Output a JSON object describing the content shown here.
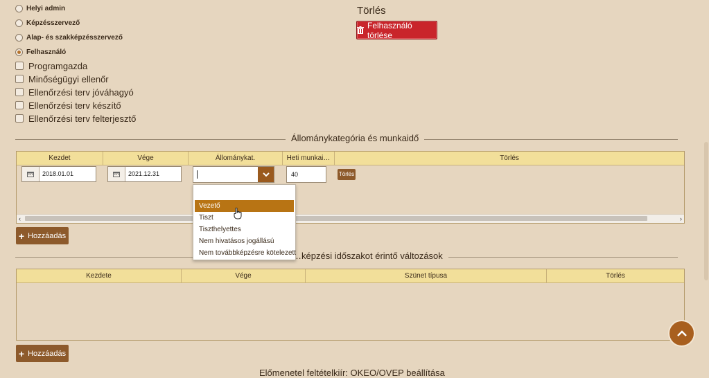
{
  "roles": [
    {
      "label": "Helyi admin",
      "checked": false
    },
    {
      "label": "Képzésszervező",
      "checked": false
    },
    {
      "label": "Alap- és szakképzésszervező",
      "checked": false
    },
    {
      "label": "Felhasználó",
      "checked": true
    }
  ],
  "permissions": [
    {
      "label": "Programgazda",
      "checked": false
    },
    {
      "label": "Minőségügyi ellenőr",
      "checked": false
    },
    {
      "label": "Ellenőrzési terv jóváhagyó",
      "checked": false
    },
    {
      "label": "Ellenőrzési terv készítő",
      "checked": false
    },
    {
      "label": "Ellenőrzési terv felterjesztő",
      "checked": false
    }
  ],
  "delete_user": {
    "title": "Törlés",
    "button_label": "Felhasználó törlése"
  },
  "staff_section": {
    "title": "Állománykategória és munkaidő",
    "columns": [
      "Kezdet",
      "Vége",
      "Állománykat.",
      "Heti munkai…",
      "Törlés"
    ],
    "row": {
      "start": "2018.01.01",
      "end": "2021.12.31",
      "category": "",
      "hours": "40",
      "delete_label": "Törlés"
    },
    "add_label": "Hozzáadás"
  },
  "dropdown": {
    "options": [
      "Vezető",
      "Tiszt",
      "Tiszthelyettes",
      "Nem hivatásos jogállású",
      "Nem továbbképzésre kötelezett"
    ],
    "highlighted": 0
  },
  "break_section": {
    "title": "…képzési időszakot érintő változások",
    "columns": [
      "Kezdete",
      "Vége",
      "Szünet típusa",
      "Törlés"
    ],
    "add_label": "Hozzáadás"
  },
  "bottom_text": "Előmenetel feltételkiír: OKEO/OVEP beállítása",
  "colors": {
    "accent": "#8d5a2b",
    "danger": "#c9252b",
    "header": "#f2df9a",
    "highlight": "#b87414"
  }
}
